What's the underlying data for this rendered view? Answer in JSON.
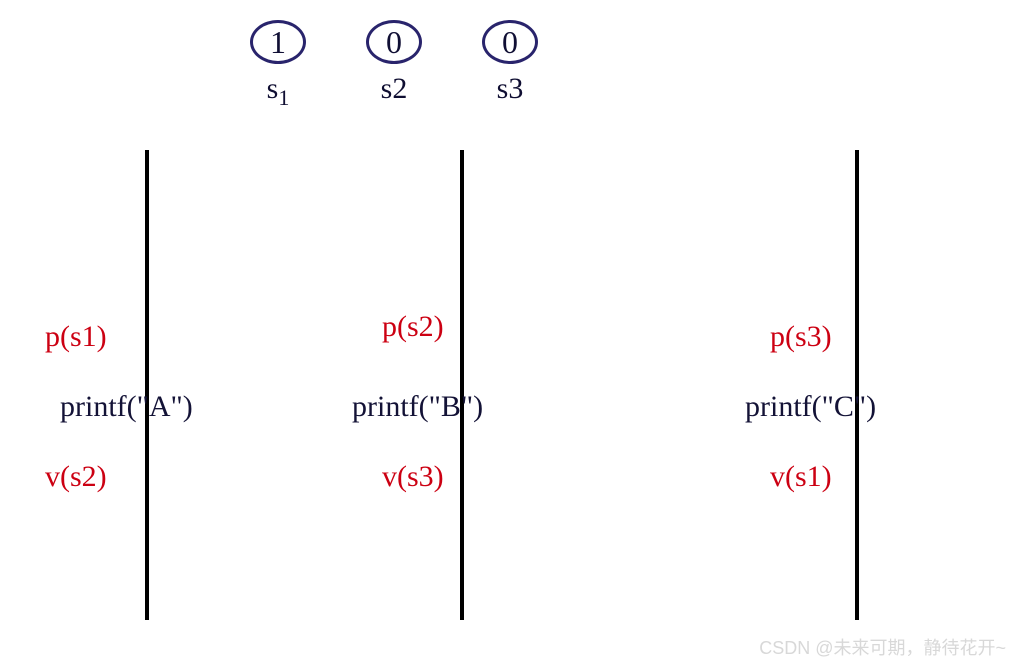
{
  "semaphores": [
    {
      "value": "1",
      "label": "s",
      "sub": "1"
    },
    {
      "value": "0",
      "label": "s2",
      "sub": ""
    },
    {
      "value": "0",
      "label": "s3",
      "sub": ""
    }
  ],
  "processes": [
    {
      "p": "p(s1)",
      "body": "printf(\"A\")",
      "v": "v(s2)"
    },
    {
      "p": "p(s2)",
      "body": "printf(\"B\")",
      "v": "v(s3)"
    },
    {
      "p": "p(s3)",
      "body": "printf(\"C\")",
      "v": "v(s1)"
    }
  ],
  "watermark": "CSDN @未来可期，静待花开~"
}
